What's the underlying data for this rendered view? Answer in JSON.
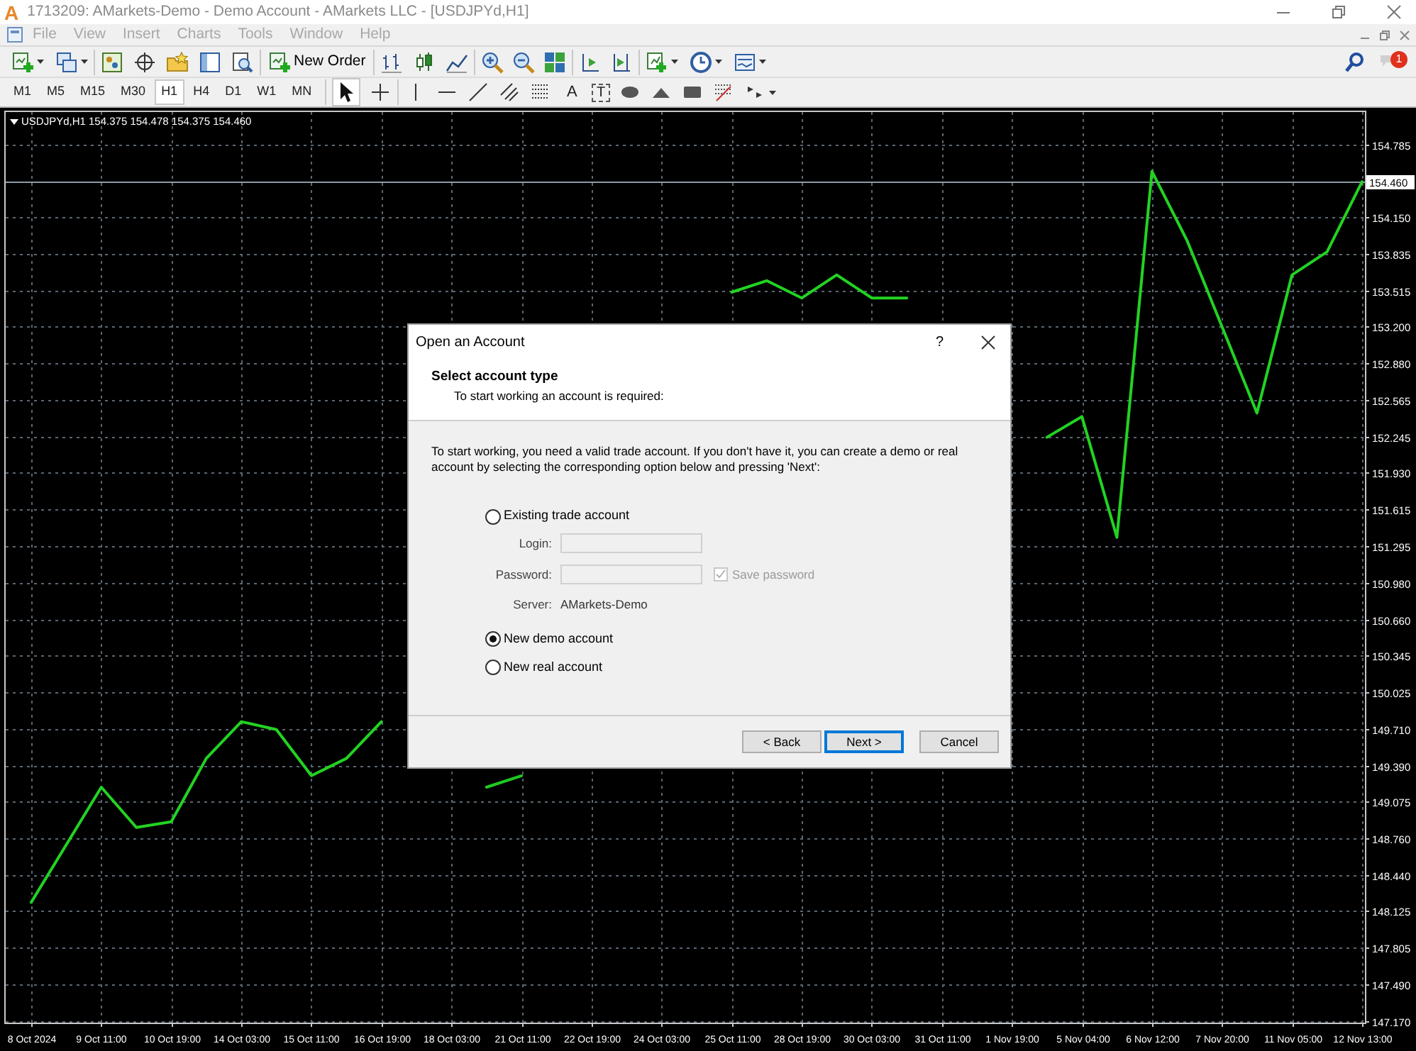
{
  "window": {
    "logo": "A",
    "title": "1713209: AMarkets-Demo - Demo Account - AMarkets LLC - [USDJPYd,H1]"
  },
  "menu_bar": {
    "items": [
      {
        "label": "File",
        "disabled": true
      },
      {
        "label": "View",
        "disabled": true
      },
      {
        "label": "Insert",
        "disabled": true
      },
      {
        "label": "Charts",
        "disabled": true
      },
      {
        "label": "Tools",
        "disabled": true
      },
      {
        "label": "Window",
        "disabled": true
      },
      {
        "label": "Help",
        "disabled": true
      }
    ]
  },
  "toolbar": {
    "new_order": "New Order",
    "notification_count": "1"
  },
  "timeframes": [
    {
      "label": "M1",
      "selected": false
    },
    {
      "label": "M5",
      "selected": false
    },
    {
      "label": "M15",
      "selected": false
    },
    {
      "label": "M30",
      "selected": false
    },
    {
      "label": "H1",
      "selected": true
    },
    {
      "label": "H4",
      "selected": false
    },
    {
      "label": "D1",
      "selected": false
    },
    {
      "label": "W1",
      "selected": false
    },
    {
      "label": "MN",
      "selected": false
    }
  ],
  "drawing_tools": {
    "text_tool": "A",
    "label_tool": "T"
  },
  "chart": {
    "header": "USDJPYd,H1 154.375 154.478 154.375 154.460",
    "chart_data": {
      "type": "line",
      "grid": true,
      "ylim": [
        147.155,
        155.065
      ],
      "ref_lines": [
        {
          "axis": "y",
          "value": 154.46,
          "label": "154.460"
        }
      ],
      "categories": [
        "8 Oct 2024",
        null,
        "9 Oct 11:00",
        null,
        "10 Oct 19:00",
        null,
        "14 Oct 03:00",
        null,
        "15 Oct 11:00",
        null,
        "16 Oct 19:00",
        null,
        "18 Oct 03:00",
        null,
        "21 Oct 11:00",
        null,
        "22 Oct 19:00",
        null,
        "24 Oct 03:00",
        null,
        "25 Oct 11:00",
        null,
        "28 Oct 19:00",
        null,
        "30 Oct 03:00",
        null,
        "31 Oct 11:00",
        null,
        "1 Nov 19:00",
        null,
        "5 Nov 04:00",
        null,
        "6 Nov 12:00",
        null,
        "7 Nov 20:00",
        null,
        "11 Nov 05:00",
        null,
        "12 Nov 13:00"
      ],
      "series": [
        {
          "color": "#22d322",
          "values": [
            148.2,
            148.7,
            149.2,
            148.85,
            148.9,
            149.45,
            149.77,
            149.7,
            149.3,
            149.45,
            149.77,
            null,
            null,
            149.2,
            149.3,
            null,
            null,
            null,
            null,
            null,
            153.5,
            153.6,
            153.45,
            153.65,
            153.45,
            153.45,
            null,
            null,
            null,
            152.24,
            152.42,
            151.37,
            154.55,
            153.95,
            153.2,
            152.45,
            153.65,
            153.85,
            154.46
          ]
        }
      ],
      "yticks": [
        {
          "value": 154.785,
          "label": "154.785"
        },
        {
          "value": 154.15,
          "label": "154.150"
        },
        {
          "value": 153.835,
          "label": "153.835"
        },
        {
          "value": 153.515,
          "label": "153.515"
        },
        {
          "value": 153.2,
          "label": "153.200"
        },
        {
          "value": 152.88,
          "label": "152.880"
        },
        {
          "value": 152.565,
          "label": "152.565"
        },
        {
          "value": 152.245,
          "label": "152.245"
        },
        {
          "value": 151.93,
          "label": "151.930"
        },
        {
          "value": 151.615,
          "label": "151.615"
        },
        {
          "value": 151.295,
          "label": "151.295"
        },
        {
          "value": 150.98,
          "label": "150.980"
        },
        {
          "value": 150.66,
          "label": "150.660"
        },
        {
          "value": 150.345,
          "label": "150.345"
        },
        {
          "value": 150.025,
          "label": "150.025"
        },
        {
          "value": 149.71,
          "label": "149.710"
        },
        {
          "value": 149.39,
          "label": "149.390"
        },
        {
          "value": 149.075,
          "label": "149.075"
        },
        {
          "value": 148.76,
          "label": "148.760"
        },
        {
          "value": 148.44,
          "label": "148.440"
        },
        {
          "value": 148.125,
          "label": "148.125"
        },
        {
          "value": 147.805,
          "label": "147.805"
        },
        {
          "value": 147.49,
          "label": "147.490"
        },
        {
          "value": 147.17,
          "label": "147.170"
        }
      ]
    }
  },
  "dialog": {
    "title": "Open an Account",
    "help": "?",
    "heading": "Select account type",
    "subheading": "To start working an account is required:",
    "text": "To start working, you need a valid trade account. If you don't have it, you can create a demo or real account by selecting the corresponding option below and pressing 'Next':",
    "options": [
      {
        "label": "Existing trade account",
        "selected": false,
        "form": {
          "disabled": true,
          "login_label": "Login:",
          "password_label": "Password:",
          "save_password": {
            "label": "Save password",
            "checked": true
          },
          "server_label": "Server:",
          "server_value": "AMarkets-Demo"
        }
      },
      {
        "label": "New demo account",
        "selected": true
      },
      {
        "label": "New real account",
        "selected": false
      }
    ],
    "buttons": [
      {
        "label": "< Back",
        "default": false
      },
      {
        "label": "Next >",
        "default": true
      },
      {
        "label": "Cancel",
        "default": false
      }
    ]
  }
}
